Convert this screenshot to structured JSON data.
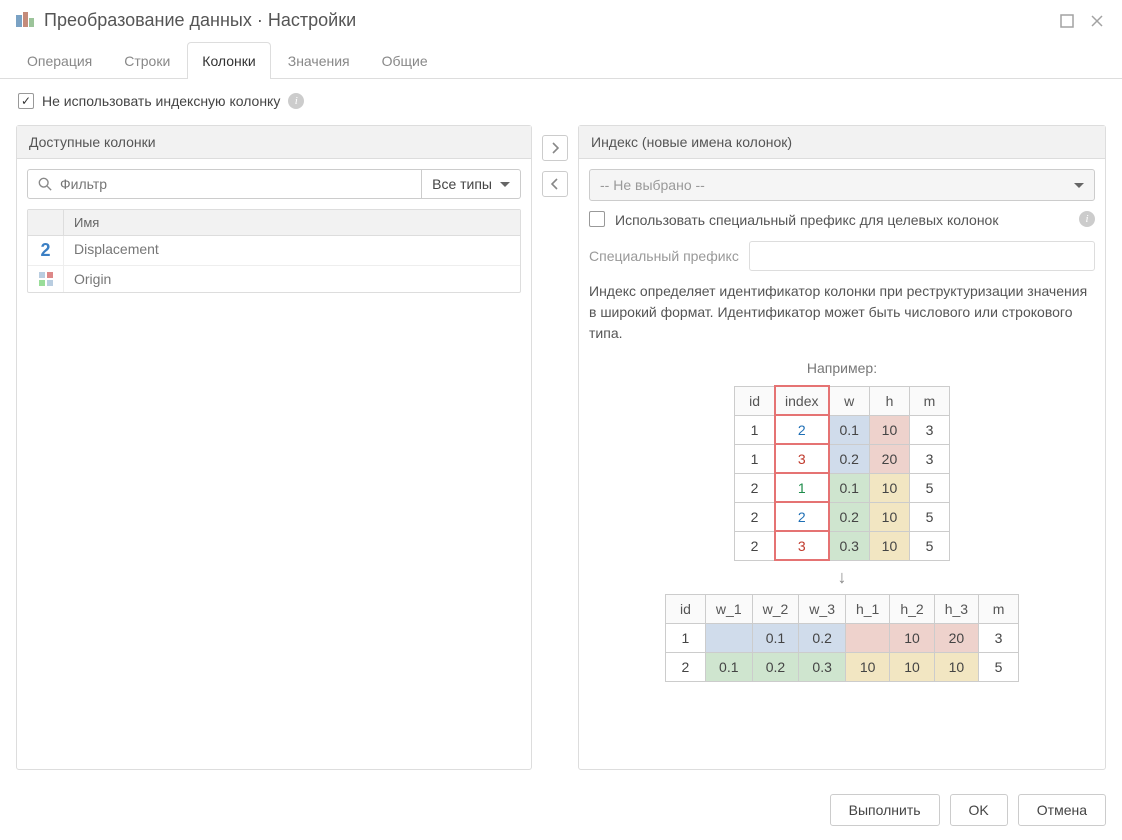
{
  "window": {
    "title": "Преобразование данных · Настройки"
  },
  "tabs": {
    "operation": "Операция",
    "rows": "Строки",
    "columns": "Колонки",
    "values": "Значения",
    "general": "Общие"
  },
  "noIndexCheckbox": {
    "label": "Не использовать индексную колонку"
  },
  "leftPanel": {
    "title": "Доступные колонки",
    "filterPlaceholder": "Фильтр",
    "typeDropdown": "Все типы",
    "colHeader": "Имя",
    "rows": {
      "r0": "Displacement",
      "r1": "Origin"
    }
  },
  "rightPanel": {
    "title": "Индекс (новые имена колонок)",
    "selectPlaceholder": "-- Не выбрано --",
    "prefixCheckboxLabel": "Использовать специальный префикс для целевых колонок",
    "prefixInputLabel": "Специальный префикс",
    "description": "Индекс определяет идентификатор колонки при реструктуризации значения в широкий формат. Идентификатор может быть числового или строкового типа.",
    "exampleLabel": "Например:"
  },
  "exampleTop": {
    "headers": {
      "id": "id",
      "index": "index",
      "w": "w",
      "h": "h",
      "m": "m"
    },
    "rows": {
      "r0": {
        "id": "1",
        "index": "2",
        "w": "0.1",
        "h": "10",
        "m": "3"
      },
      "r1": {
        "id": "1",
        "index": "3",
        "w": "0.2",
        "h": "20",
        "m": "3"
      },
      "r2": {
        "id": "2",
        "index": "1",
        "w": "0.1",
        "h": "10",
        "m": "5"
      },
      "r3": {
        "id": "2",
        "index": "2",
        "w": "0.2",
        "h": "10",
        "m": "5"
      },
      "r4": {
        "id": "2",
        "index": "3",
        "w": "0.3",
        "h": "10",
        "m": "5"
      }
    }
  },
  "exampleBottom": {
    "headers": {
      "id": "id",
      "w1": "w_1",
      "w2": "w_2",
      "w3": "w_3",
      "h1": "h_1",
      "h2": "h_2",
      "h3": "h_3",
      "m": "m"
    },
    "rows": {
      "r0": {
        "id": "1",
        "w1": "",
        "w2": "0.1",
        "w3": "0.2",
        "h1": "",
        "h2": "10",
        "h3": "20",
        "m": "3"
      },
      "r1": {
        "id": "2",
        "w1": "0.1",
        "w2": "0.2",
        "w3": "0.3",
        "h1": "10",
        "h2": "10",
        "h3": "10",
        "m": "5"
      }
    }
  },
  "footer": {
    "run": "Выполнить",
    "ok": "OK",
    "cancel": "Отмена"
  }
}
